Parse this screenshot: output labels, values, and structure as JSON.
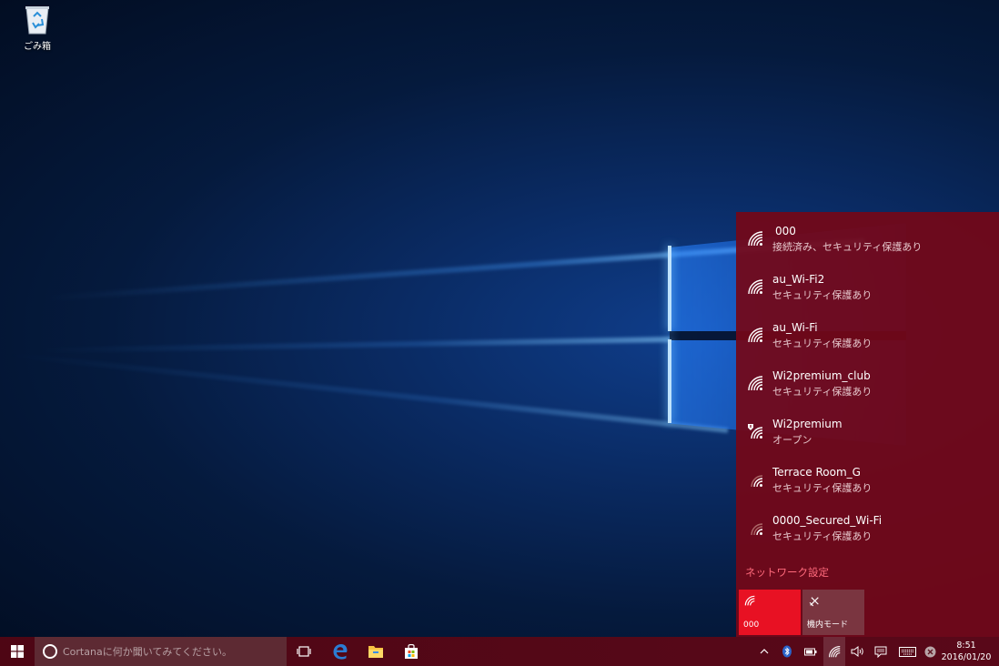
{
  "desktop": {
    "icons": [
      {
        "label": "ごみ箱",
        "icon": "recycle-bin-icon"
      }
    ]
  },
  "network_flyout": {
    "networks": [
      {
        "name": "000",
        "status": "接続済み、セキュリティ保護あり",
        "icon": "wifi-signal-icon"
      },
      {
        "name": "au_Wi-Fi2",
        "status": "セキュリティ保護あり",
        "icon": "wifi-signal-icon"
      },
      {
        "name": "au_Wi-Fi",
        "status": "セキュリティ保護あり",
        "icon": "wifi-signal-icon"
      },
      {
        "name": "Wi2premium_club",
        "status": "セキュリティ保護あり",
        "icon": "wifi-signal-icon"
      },
      {
        "name": "Wi2premium",
        "status": "オープン",
        "icon": "wifi-warning-icon"
      },
      {
        "name": "Terrace Room_G",
        "status": "セキュリティ保護あり",
        "icon": "wifi-signal-icon"
      },
      {
        "name": "0000_Secured_Wi-Fi",
        "status": "セキュリティ保護あり",
        "icon": "wifi-signal-icon"
      }
    ],
    "settings_link": "ネットワーク設定",
    "tiles": [
      {
        "label": "000",
        "icon": "wifi-icon",
        "active": true,
        "color": "#e81123"
      },
      {
        "label": "機内モード",
        "icon": "airplane-icon",
        "active": false,
        "color": "#7a3540"
      }
    ]
  },
  "taskbar": {
    "search_placeholder": "Cortanaに何か聞いてみてください。",
    "apps": [
      "task-view-icon",
      "edge-icon",
      "file-explorer-icon",
      "store-icon"
    ],
    "tray_icons": [
      "chevron-up-icon",
      "bluetooth-icon",
      "battery-icon",
      "wifi-icon",
      "volume-icon",
      "action-center-icon",
      "keyboard-icon",
      "close-circle-icon"
    ],
    "time": "8:51",
    "date": "2016/01/20"
  },
  "colors": {
    "accent": "#e81123",
    "flyout_bg": "#740818",
    "link": "#ff6a7c"
  }
}
